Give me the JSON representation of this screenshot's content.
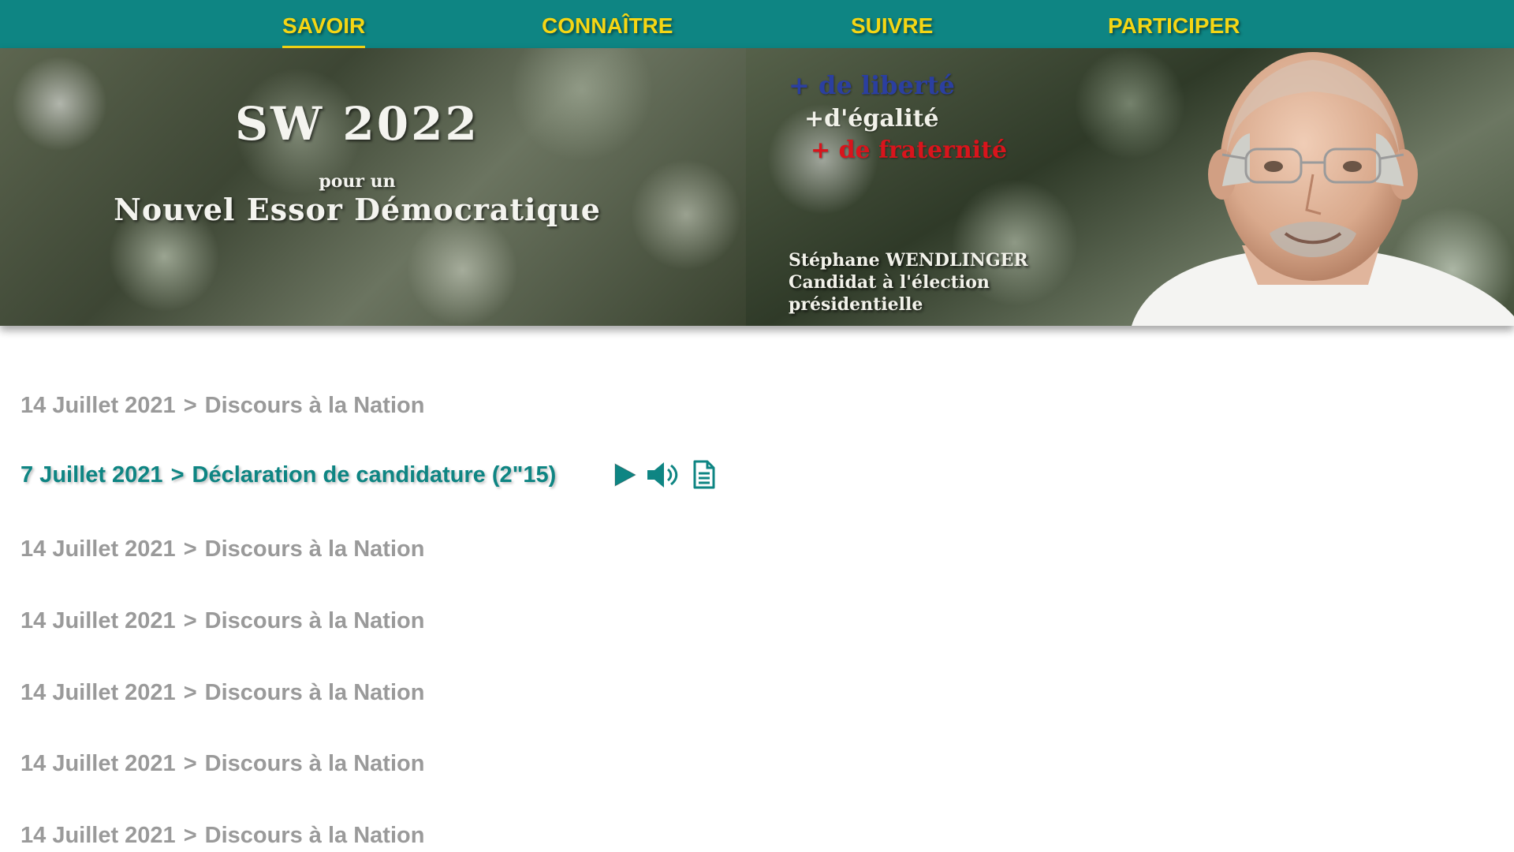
{
  "nav": {
    "items": [
      {
        "label": "SAVOIR",
        "active": true
      },
      {
        "label": "CONNAÎTRE",
        "active": false
      },
      {
        "label": "SUIVRE",
        "active": false
      },
      {
        "label": "PARTICIPER",
        "active": false
      }
    ]
  },
  "banner": {
    "title": "SW 2022",
    "subtitle_small": "pour un",
    "subtitle_large": "Nouvel Essor Démocratique",
    "slogan": {
      "liberte": "+ de liberté",
      "egalite": "+d'égalité",
      "fraternite": "+ de fraternité"
    },
    "candidate_name": "Stéphane WENDLINGER",
    "candidate_role_1": "Candidat à l'élection",
    "candidate_role_2": "présidentielle"
  },
  "list": {
    "items": [
      {
        "date": "14 Juillet 2021",
        "separator": ">",
        "title": "Discours à la Nation"
      },
      {
        "date": "7 Juillet 2021",
        "separator": ">",
        "title": "Déclaration de candidature (2\"15)"
      },
      {
        "date": "14 Juillet 2021",
        "separator": ">",
        "title": "Discours à la Nation"
      },
      {
        "date": "14 Juillet 2021",
        "separator": ">",
        "title": "Discours à la Nation"
      },
      {
        "date": "14 Juillet 2021",
        "separator": ">",
        "title": "Discours à la Nation"
      },
      {
        "date": "14 Juillet 2021",
        "separator": ">",
        "title": "Discours à la Nation"
      },
      {
        "date": "14 Juillet 2021",
        "separator": ">",
        "title": "Discours à la Nation"
      }
    ],
    "active_index": 1,
    "media_icons": [
      "play-icon",
      "speaker-icon",
      "document-icon"
    ]
  },
  "colors": {
    "nav_bg": "#0e8583",
    "nav_text": "#f5d614",
    "active_text": "#0e8583",
    "inactive_text": "#9a9a9a",
    "slogan_blue": "#2b3fa0",
    "slogan_red": "#d9141c"
  }
}
